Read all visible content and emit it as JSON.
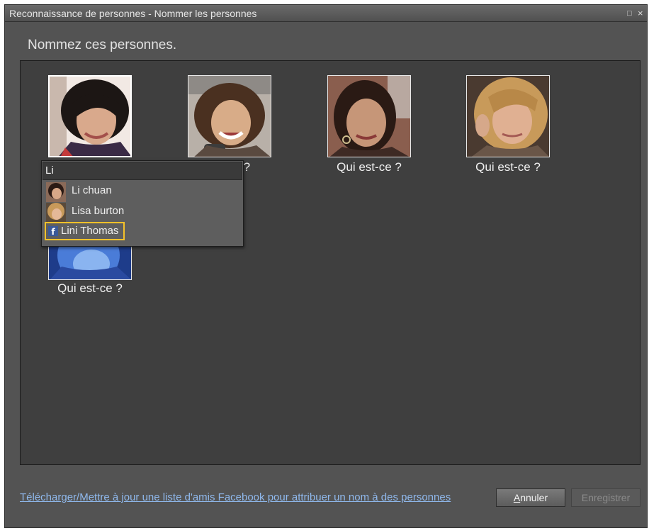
{
  "window": {
    "title": "Reconnaissance de personnes - Nommer les personnes",
    "controls": {
      "restore": "□",
      "close": "×"
    }
  },
  "heading": "Nommez ces personnes.",
  "faces": [
    {
      "caption": "",
      "selected": true
    },
    {
      "caption": "ce ?"
    },
    {
      "caption": "Qui est-ce ?"
    },
    {
      "caption": "Qui est-ce ?"
    },
    {
      "caption": "Qui est-ce ?"
    }
  ],
  "autocomplete": {
    "input_value": "Li",
    "suggestions": [
      {
        "label": "Li chuan",
        "source": "person"
      },
      {
        "label": "Lisa burton",
        "source": "person"
      },
      {
        "label": "Lini Thomas",
        "source": "facebook",
        "highlighted": true
      }
    ],
    "facebook_icon": "f"
  },
  "footer": {
    "facebook_link": "Télécharger/Mettre à jour une liste d'amis Facebook pour attribuer un nom à des personnes",
    "cancel_label_underlined": "A",
    "cancel_label_rest": "nnuler",
    "save_label": "Enregistrer"
  },
  "colors": {
    "highlight": "#f5c12a",
    "facebook": "#3b5998",
    "link": "#8fb8ec"
  }
}
